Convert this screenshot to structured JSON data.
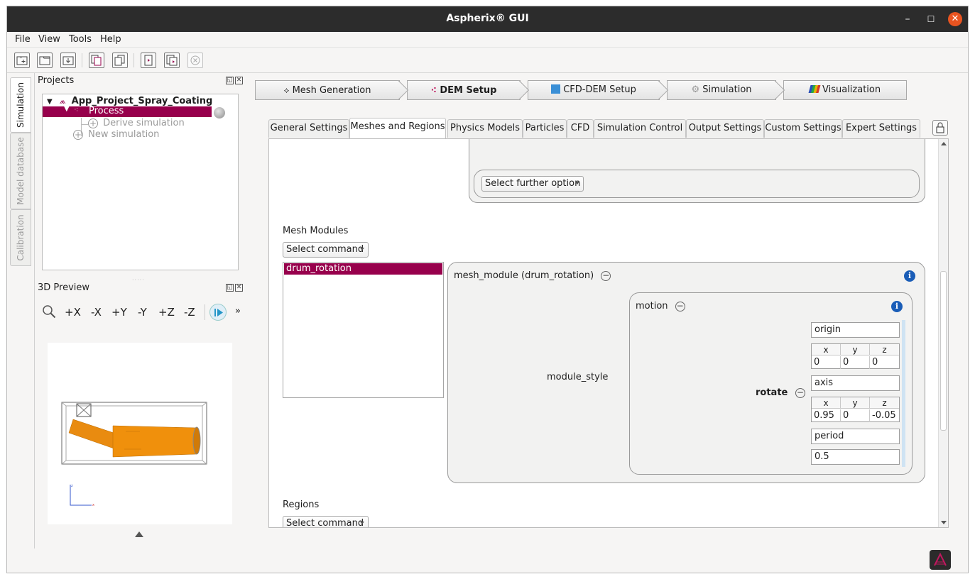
{
  "window": {
    "title": "Aspherix® GUI",
    "minimize": "–",
    "maximize": "☐",
    "close": "✕"
  },
  "menu": [
    "File",
    "View",
    "Tools",
    "Help"
  ],
  "side_tabs": [
    "Simulation",
    "Model database",
    "Calibration"
  ],
  "projects_panel": {
    "title": "Projects",
    "project_name": "App_Project_Spray_Coating",
    "process": "Process",
    "derive": "Derive simulation",
    "new_sim": "New simulation"
  },
  "preview_panel": {
    "title": "3D Preview",
    "buttons": [
      "+X",
      "-X",
      "+Y",
      "-Y",
      "+Z",
      "-Z"
    ],
    "more": "»"
  },
  "stages": [
    {
      "label": "Mesh Generation",
      "icon": "mesh-icon"
    },
    {
      "label": "DEM Setup",
      "icon": "dem-icon"
    },
    {
      "label": "CFD-DEM Setup",
      "icon": "cfd-icon"
    },
    {
      "label": "Simulation",
      "icon": "gear-icon"
    },
    {
      "label": "Visualization",
      "icon": "visualization-icon"
    }
  ],
  "tabs": [
    "General Settings",
    "Meshes and Regions",
    "Physics Models",
    "Particles",
    "CFD",
    "Simulation Control",
    "Output Settings",
    "Custom Settings",
    "Expert Settings"
  ],
  "content": {
    "further_option": "Select further option",
    "mesh_modules_label": "Mesh Modules",
    "select_command": "Select command",
    "module_list": [
      "drum_rotation"
    ],
    "mesh_module_title": "mesh_module (drum_rotation)",
    "motion_title": "motion",
    "module_style_label": "module_style",
    "rotate_label": "rotate",
    "origin_label": "origin",
    "origin": {
      "x": "0",
      "y": "0",
      "z": "0"
    },
    "axis_label": "axis",
    "axis": {
      "x": "0.95",
      "y": "0",
      "z": "-0.05"
    },
    "period_label": "period",
    "period_value": "0.5",
    "xyz_headers": [
      "x",
      "y",
      "z"
    ],
    "regions_label": "Regions",
    "regions_command": "Select command"
  },
  "colors": {
    "accent": "#97004c",
    "titlebar": "#2c2c2c",
    "close": "#e95420",
    "info": "#1a5db7",
    "drum": "#f0900c"
  }
}
